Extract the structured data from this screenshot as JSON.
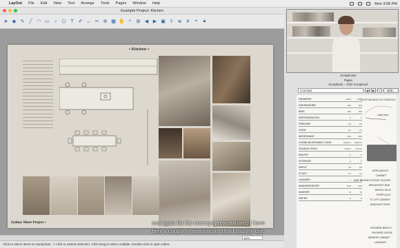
{
  "menubar": {
    "app": "LayOut",
    "items": [
      "File",
      "Edit",
      "View",
      "Text",
      "Arrange",
      "Tools",
      "Pages",
      "Window",
      "Help"
    ],
    "clock": "Mon 3:58 PM"
  },
  "window": {
    "title": "Example Project- Kitchen"
  },
  "document": {
    "page_title": "Kitchen",
    "project_label": "Sydney Shore Project",
    "zoom": "60%"
  },
  "status": {
    "text": "Click to select items to manipulate. ⇧-click to extend selection. Click-drag to select multiple. Double-click to open editor."
  },
  "tray": {
    "header1": "Scrapbooks",
    "header2": "Pages",
    "header3": "Scrapbook – VDD Scrapbook",
    "concept": "Concept",
    "edit_label": "Edit..."
  },
  "scrapbook": {
    "rows": [
      {
        "name": "DRAWERS",
        "a": "DRW",
        "b": "DRW"
      },
      {
        "name": "DISHWASHER",
        "a": "DW",
        "b": "DW"
      },
      {
        "name": "BINS",
        "a": "BIN",
        "b": "BIN"
      },
      {
        "name": "REFRIGERATION",
        "a": "F",
        "b": "F"
      },
      {
        "name": "FREEZER",
        "a": "FR",
        "b": "FR"
      },
      {
        "name": "OVEN",
        "a": "OV",
        "b": "OV"
      },
      {
        "name": "MICROWAVE",
        "a": "MW",
        "b": "MW"
      },
      {
        "name": "COMBI MICROWAVE OVEN",
        "a": "MW/OV",
        "b": "MW/OV"
      },
      {
        "name": "DOUBLE OVEN",
        "a": "OV/OV",
        "b": "OV/OV"
      },
      {
        "name": "PANTRY",
        "a": "P",
        "b": "P"
      },
      {
        "name": "STORAGE",
        "a": "S",
        "b": "S"
      },
      {
        "name": "SHELF",
        "a": "SH",
        "b": "SH"
      },
      {
        "name": "STUDY",
        "a": "ST",
        "b": "ST"
      },
      {
        "name": "LAUNDRY",
        "a": "L",
        "b": "L"
      },
      {
        "name": "WASHER/DRYER",
        "a": "W/D",
        "b": "W/D"
      },
      {
        "name": "WASHER",
        "a": "W",
        "b": "W"
      },
      {
        "name": "DRYER",
        "a": "D",
        "b": "D"
      }
    ],
    "annotations": [
      "CUSTOM BUILT-IN CONSOLE",
      "Label text",
      "APPLIANCES",
      "CABINET",
      "BAR BEHIND POCKET DOORS",
      "BREAKFAST BAR",
      "BENCH SEAT",
      "FIREPLACE",
      "TV LIFT CABINET",
      "BAKESUP DESK",
      "SHOWER BENCH",
      "SHOWER LEDGE",
      "MIRROR CABINET",
      "LAUNDRY"
    ]
  },
  "subtitle": {
    "line1": "and again for the concept presentations, I have",
    "line2": "here a couple of annotations that I usually use."
  }
}
